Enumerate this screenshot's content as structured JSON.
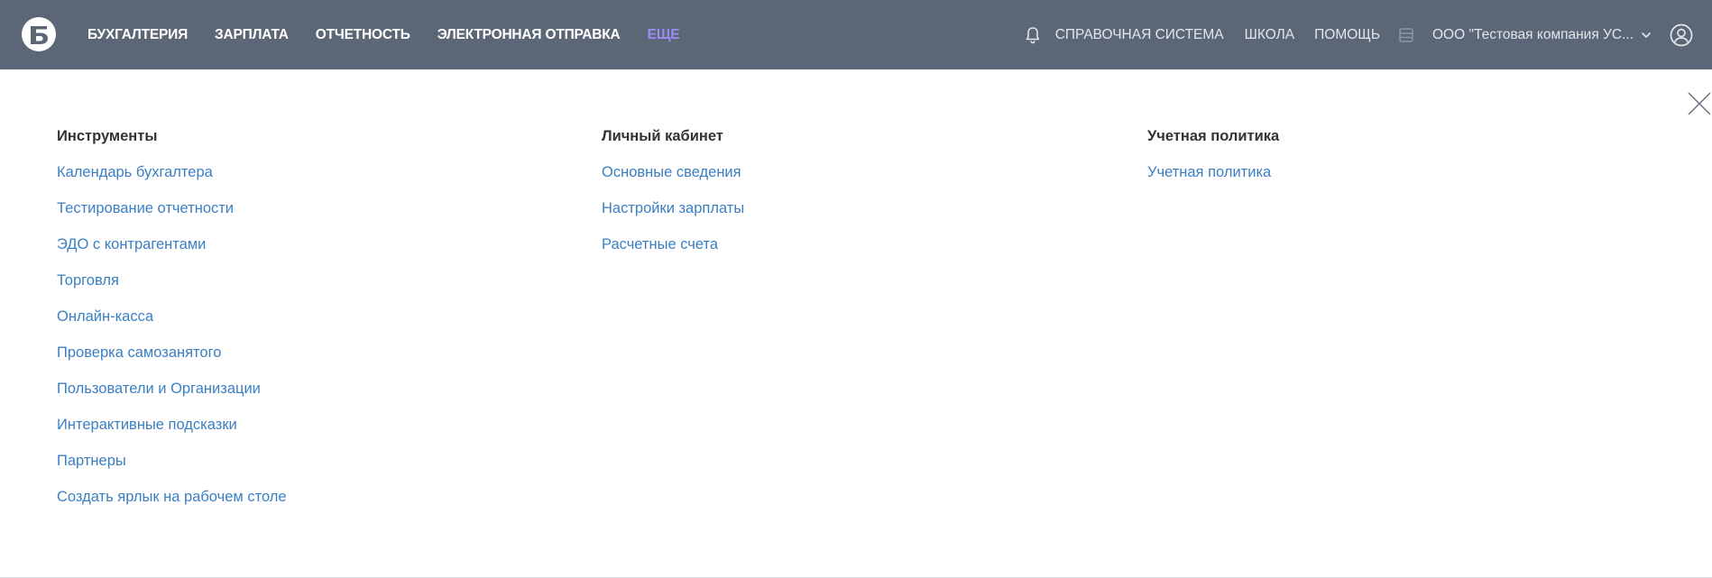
{
  "header": {
    "nav": [
      {
        "label": "БУХГАЛТЕРИЯ",
        "active": false
      },
      {
        "label": "ЗАРПЛАТА",
        "active": false
      },
      {
        "label": "ОТЧЕТНОСТЬ",
        "active": false
      },
      {
        "label": "ЭЛЕКТРОННАЯ ОТПРАВКА",
        "active": false
      },
      {
        "label": "ЕЩЕ",
        "active": true
      }
    ],
    "right": {
      "reference": "СПРАВОЧНАЯ СИСТЕМА",
      "school": "ШКОЛА",
      "help": "ПОМОЩЬ",
      "company": "ООО \"Тестовая компания УС..."
    },
    "colors": {
      "bar": "#5b6677",
      "active": "#9c8cf0"
    }
  },
  "menu": {
    "columns": [
      {
        "title": "Инструменты",
        "links": [
          "Календарь бухгалтера",
          "Тестирование отчетности",
          "ЭДО с контрагентами",
          "Торговля",
          "Онлайн-касса",
          "Проверка самозанятого",
          "Пользователи и Организации",
          "Интерактивные подсказки",
          "Партнеры",
          "Создать ярлык на рабочем столе"
        ]
      },
      {
        "title": "Личный кабинет",
        "links": [
          "Основные сведения",
          "Настройки зарплаты",
          "Расчетные счета"
        ]
      },
      {
        "title": "Учетная политика",
        "links": [
          "Учетная политика"
        ]
      }
    ],
    "link_color": "#3a7fc4"
  },
  "icons": {
    "logo": "logo-icon",
    "bell": "bell-icon",
    "archive": "archive-icon",
    "chevron": "chevron-down-icon",
    "user": "user-icon",
    "close": "close-icon"
  }
}
